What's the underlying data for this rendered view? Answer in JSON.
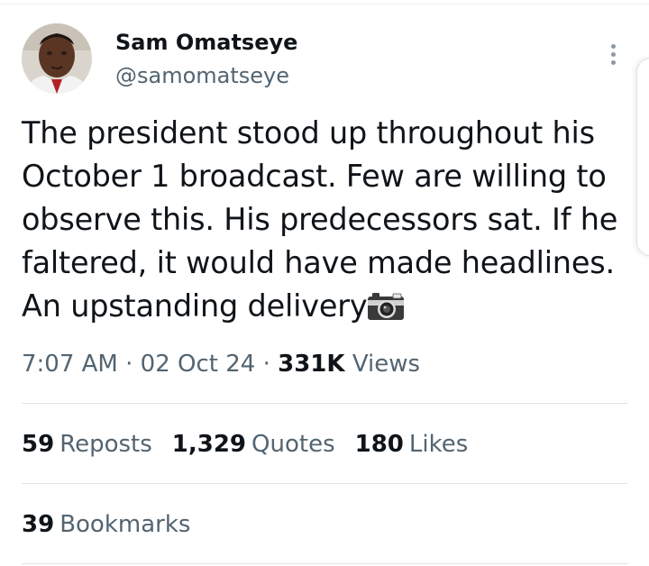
{
  "author": {
    "name": "Sam Omatseye",
    "handle": "@samomatseye"
  },
  "tweet": {
    "text": "The president stood up throughout his\nOctober 1 broadcast. Few are willing to\nobserve this. His predecessors sat. If he\nfaltered, it would have made headlines.\nAn upstanding delivery",
    "emoji_icon": "camera-with-flash-icon"
  },
  "meta": {
    "time": "7:07 AM",
    "separator": "·",
    "date": "02 Oct 24",
    "views_count": "331K",
    "views_label": "Views"
  },
  "stats": {
    "reposts_count": "59",
    "reposts_label": "Reposts",
    "quotes_count": "1,329",
    "quotes_label": "Quotes",
    "likes_count": "180",
    "likes_label": "Likes",
    "bookmarks_count": "39",
    "bookmarks_label": "Bookmarks"
  },
  "colors": {
    "text_primary": "#0f1419",
    "text_secondary": "#536471",
    "divider": "#dfe3e6"
  }
}
